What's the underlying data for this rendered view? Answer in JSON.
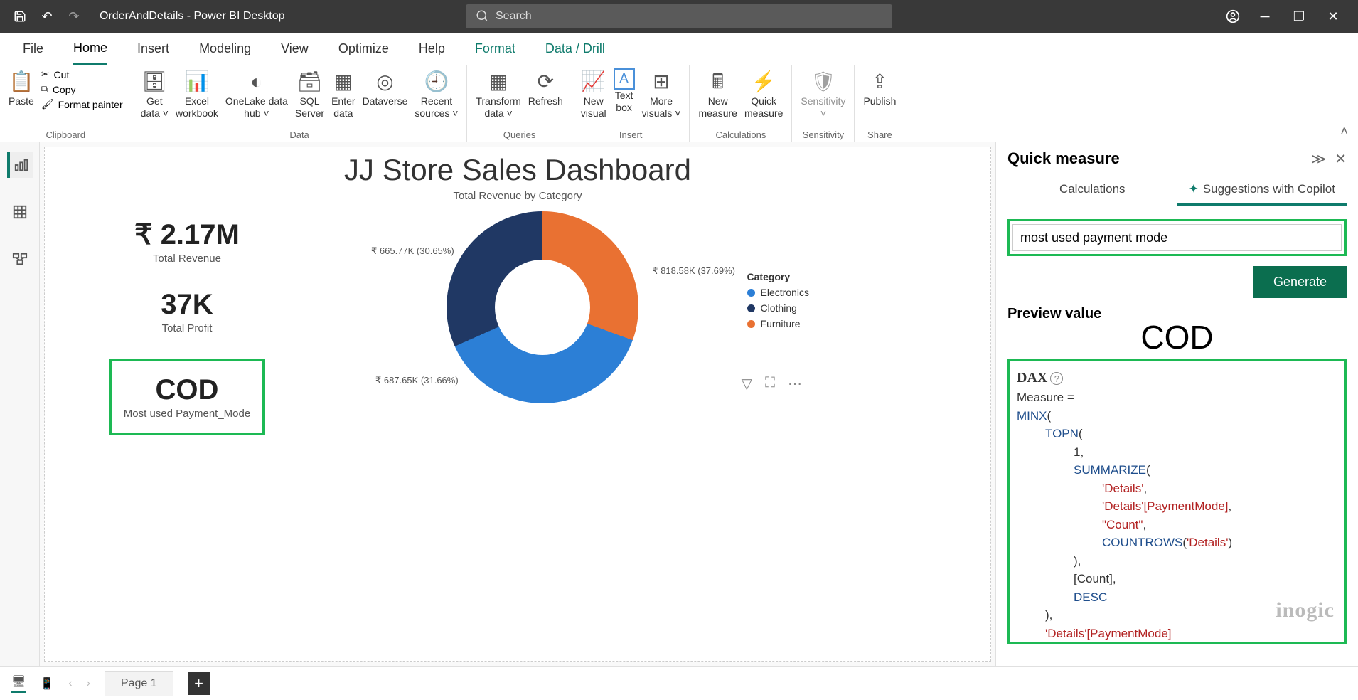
{
  "titlebar": {
    "app_title": "OrderAndDetails - Power BI Desktop",
    "search_placeholder": "Search"
  },
  "menu": {
    "file": "File",
    "home": "Home",
    "insert": "Insert",
    "modeling": "Modeling",
    "view": "View",
    "optimize": "Optimize",
    "help": "Help",
    "format": "Format",
    "datadrill": "Data / Drill"
  },
  "ribbon": {
    "clipboard": {
      "paste": "Paste",
      "cut": "Cut",
      "copy": "Copy",
      "painter": "Format painter",
      "group": "Clipboard"
    },
    "data": {
      "getdata": "Get",
      "getdata2": "data",
      "excel": "Excel",
      "excel2": "workbook",
      "onelake": "OneLake data",
      "onelake2": "hub",
      "sql": "SQL",
      "sql2": "Server",
      "enter": "Enter",
      "enter2": "data",
      "dataverse": "Dataverse",
      "recent": "Recent",
      "recent2": "sources",
      "group": "Data"
    },
    "queries": {
      "transform": "Transform",
      "transform2": "data",
      "refresh": "Refresh",
      "group": "Queries"
    },
    "insert": {
      "newvis": "New",
      "newvis2": "visual",
      "text": "Text",
      "text2": "box",
      "more": "More",
      "more2": "visuals",
      "group": "Insert"
    },
    "calc": {
      "newmeas": "New",
      "newmeas2": "measure",
      "quick": "Quick",
      "quick2": "measure",
      "group": "Calculations"
    },
    "sens": {
      "label": "Sensitivity",
      "group": "Sensitivity"
    },
    "share": {
      "label": "Publish",
      "group": "Share"
    }
  },
  "dashboard": {
    "title": "JJ Store Sales Dashboard",
    "subtitle": "Total Revenue by Category",
    "kpi1_val": "₹ 2.17M",
    "kpi1_lbl": "Total Revenue",
    "kpi2_val": "37K",
    "kpi2_lbl": "Total Profit",
    "kpi3_val": "COD",
    "kpi3_lbl": "Most used Payment_Mode",
    "donut_l1": "₹ 665.77K (30.65%)",
    "donut_l2": "₹ 818.58K (37.69%)",
    "donut_l3": "₹ 687.65K (31.66%)",
    "legend_title": "Category",
    "legend_1": "Electronics",
    "legend_2": "Clothing",
    "legend_3": "Furniture"
  },
  "chart_data": {
    "type": "pie",
    "title": "Total Revenue by Category",
    "series": [
      {
        "name": "Electronics",
        "value": 818580,
        "percent": 37.69,
        "color": "#2C7FD6"
      },
      {
        "name": "Clothing",
        "value": 687650,
        "percent": 31.66,
        "color": "#203864"
      },
      {
        "name": "Furniture",
        "value": 665770,
        "percent": 30.65,
        "color": "#E97132"
      }
    ],
    "currency": "INR",
    "display_unit": "K"
  },
  "panel": {
    "title": "Quick measure",
    "tab_calc": "Calculations",
    "tab_copilot": "Suggestions with Copilot",
    "input_value": "most used payment mode",
    "generate": "Generate",
    "preview_label": "Preview value",
    "preview_value": "COD",
    "dax_label": "DAX",
    "watermark": "inogic",
    "dax_lines": {
      "l0": "Measure =",
      "l1": "MINX",
      "l2": "TOPN",
      "l3": "1",
      "l4": "SUMMARIZE",
      "l5": "'Details'",
      "l6": "'Details'[PaymentMode]",
      "l7": "\"Count\"",
      "l8": "COUNTROWS",
      "l8b": "'Details'",
      "l9": "[Count]",
      "l10": "DESC",
      "l11": "'Details'[PaymentMode]"
    }
  },
  "bottom": {
    "page1": "Page 1"
  }
}
